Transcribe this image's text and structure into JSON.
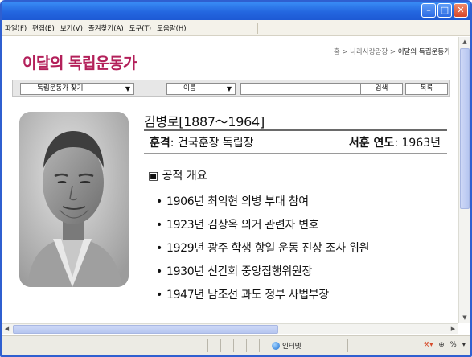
{
  "window": {
    "buttons": {
      "minimize": "–",
      "maximize": "□",
      "close": "✕"
    }
  },
  "menu": [
    "파일(F)",
    "편집(E)",
    "보기(V)",
    "즐겨찾기(A)",
    "도구(T)",
    "도움말(H)"
  ],
  "page": {
    "title": "이달의 독립운동가",
    "breadcrumb": {
      "home": "홈",
      "sep": ">",
      "section": "나라사랑광장",
      "current": "이달의 독립운동가"
    }
  },
  "search": {
    "category_select": "독립운동가 찾기",
    "field_select": "이름",
    "query": "",
    "search_button": "검색",
    "list_button": "목록"
  },
  "profile": {
    "name": "김병로[1887～1964]",
    "merit_label": "훈격",
    "merit_value": ": 건국훈장 독립장",
    "year_label": "서훈 연도",
    "year_value": ": 1963년",
    "section_heading": "▣ 공적 개요",
    "achievements": [
      "1906년  최익현 의병 부대 참여",
      "1923년  김상옥 의거 관련자 변호",
      "1929년  광주 학생 항일 운동 진상 조사 위원",
      "1930년  신간회 중앙집행위원장",
      "1947년  남조선 과도 정부 사법부장"
    ]
  },
  "status": {
    "zone": "인터넷",
    "zoom_icon": "⊕",
    "percent": "%"
  },
  "colors": {
    "titlebar": "#2467e0",
    "page_title": "#b3205a"
  }
}
